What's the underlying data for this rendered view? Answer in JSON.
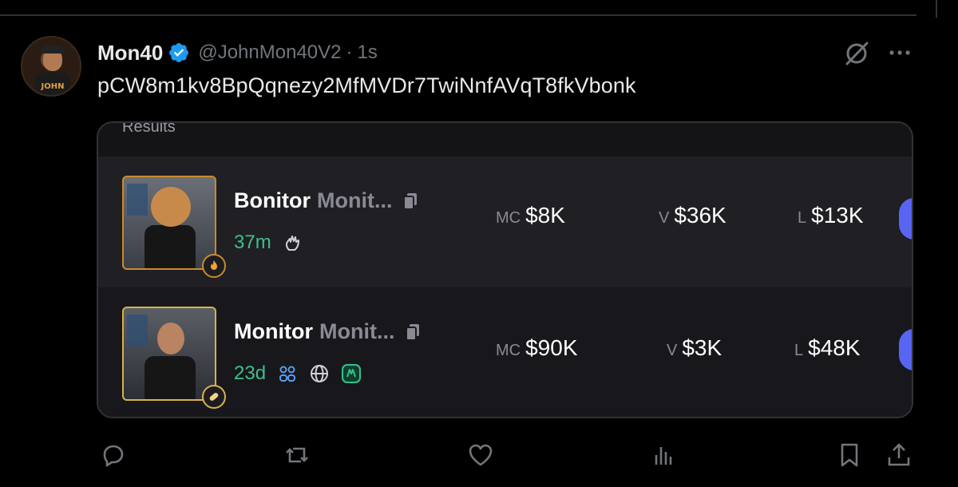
{
  "post": {
    "display_name": "Mon40",
    "handle": "@JohnMon40V2",
    "separator": "·",
    "time_ago": "1s",
    "avatar_text": "JOHN",
    "text": "pCW8m1kv8BpQqnezy2MfMVDr7TwiNnfAVqT8fkVbonk"
  },
  "card": {
    "header_label": "Results",
    "rows": [
      {
        "name": "Bonitor",
        "symbol": "Monit...",
        "age": "37m",
        "mc_label": "MC",
        "mc_value": "$8K",
        "v_label": "V",
        "v_value": "$36K",
        "l_label": "L",
        "l_value": "$13K"
      },
      {
        "name": "Monitor",
        "symbol": "Monit...",
        "age": "23d",
        "mc_label": "MC",
        "mc_value": "$90K",
        "v_label": "V",
        "v_value": "$3K",
        "l_label": "L",
        "l_value": "$48K"
      }
    ]
  },
  "colors": {
    "background": "#000000",
    "verified_blue": "#1d9bf0",
    "age_green": "#3fbf8a",
    "accent_purple": "#5865f2",
    "thumb_border_orange": "#c98a2c",
    "thumb_border_gold": "#d6b24a"
  },
  "icons": [
    "verified-icon",
    "grok-icon",
    "more-icon",
    "copy-icon",
    "pump-hand-icon",
    "community-icon",
    "globe-icon",
    "dex-icon",
    "fire-badge-icon",
    "pill-badge-icon",
    "reply-icon",
    "retweet-icon",
    "like-icon",
    "views-icon",
    "bookmark-icon",
    "share-icon"
  ]
}
